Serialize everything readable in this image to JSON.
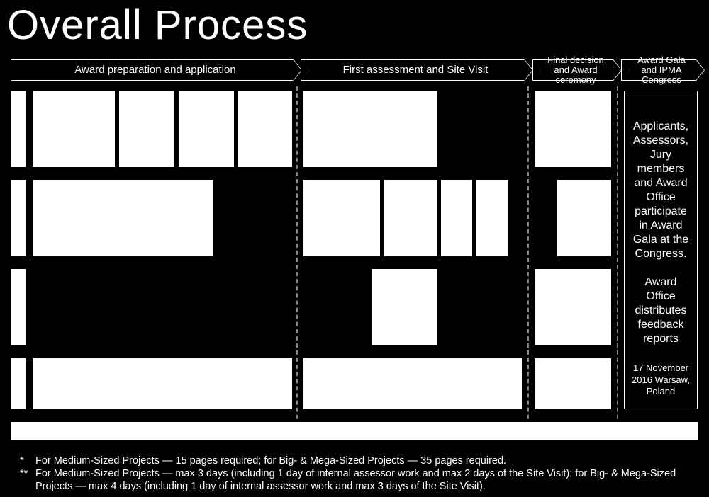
{
  "title": "Overall Process",
  "phases": {
    "p1": "Award preparation and application",
    "p2": "First assessment and Site Visit",
    "p3": "Final decision and Award ceremony",
    "p4": "Award Gala and IPMA Congress"
  },
  "phase4_panel": {
    "body": "Applicants, Assessors, Jury members and Award Office participate in Award Gala at the Congress.",
    "body2": "Award Office distributes feedback reports",
    "date": "17 November 2016 Warsaw, Poland"
  },
  "footnotes": {
    "f1_star": "*",
    "f1": "For Medium-Sized Projects — 15 pages required; for Big- & Mega-Sized Projects — 35 pages required.",
    "f2_star": "**",
    "f2": "For Medium-Sized Projects — max 3 days (including 1 day of internal assessor work and max 2 days of the Site Visit); for Big- & Mega-Sized Projects — max 4 days (including 1 day of internal assessor work and  max 3 days of the Site Visit)."
  }
}
